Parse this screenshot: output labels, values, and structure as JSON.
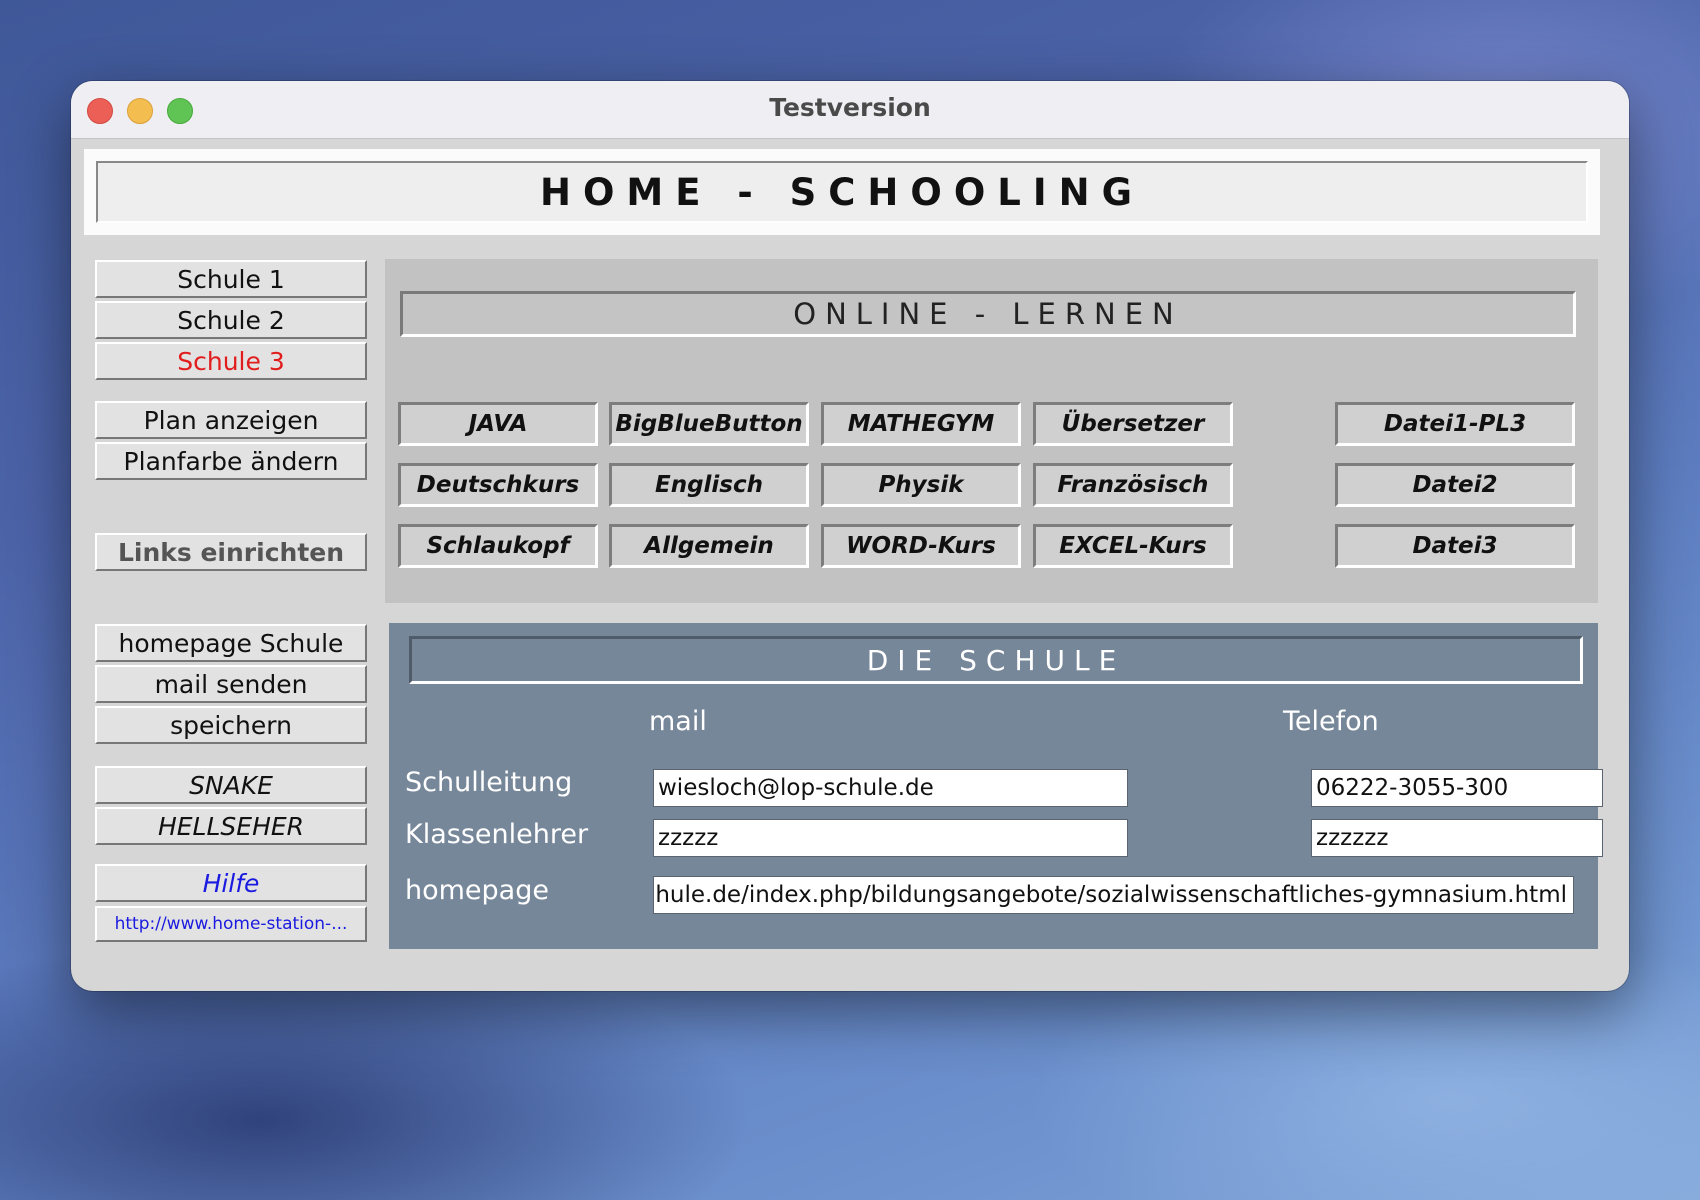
{
  "window": {
    "title": "Testversion"
  },
  "banner": {
    "title": "HOME - SCHOOLING"
  },
  "sidebar": {
    "schools": [
      "Schule 1",
      "Schule 2",
      "Schule 3"
    ],
    "plan_show": "Plan anzeigen",
    "plan_color": "Planfarbe ändern",
    "links_setup": "Links einrichten",
    "homepage": "homepage Schule",
    "mail": "mail senden",
    "save": "speichern",
    "snake": "SNAKE",
    "hellseher": "HELLSEHER",
    "help": "Hilfe",
    "link": "http://www.home-station-..."
  },
  "online": {
    "title": "ONLINE - LERNEN",
    "row1": [
      "JAVA",
      "BigBlueButton",
      "MATHEGYM",
      "Übersetzer"
    ],
    "row2": [
      "Deutschkurs",
      "Englisch",
      "Physik",
      "Französisch"
    ],
    "row3": [
      "Schlaukopf",
      "Allgemein",
      "WORD-Kurs",
      "EXCEL-Kurs"
    ],
    "files": [
      "Datei1-PL3",
      "Datei2",
      "Datei3"
    ]
  },
  "schule": {
    "title": "DIE SCHULE",
    "col_mail": "mail",
    "col_phone": "Telefon",
    "rows": {
      "leitung": {
        "label": "Schulleitung",
        "mail": "wiesloch@lop-schule.de",
        "phone": "06222-3055-300"
      },
      "lehrer": {
        "label": "Klassenlehrer",
        "mail": "zzzzz",
        "phone": "zzzzzz"
      },
      "homepage": {
        "label": "homepage",
        "value": "-schule.de/index.php/bildungsangebote/sozialwissenschaftliches-gymnasium.html"
      }
    }
  },
  "colors": {
    "accent_red": "#e21d1d",
    "link_blue": "#1a1ae0",
    "panel_blue_grey": "#77879a"
  }
}
